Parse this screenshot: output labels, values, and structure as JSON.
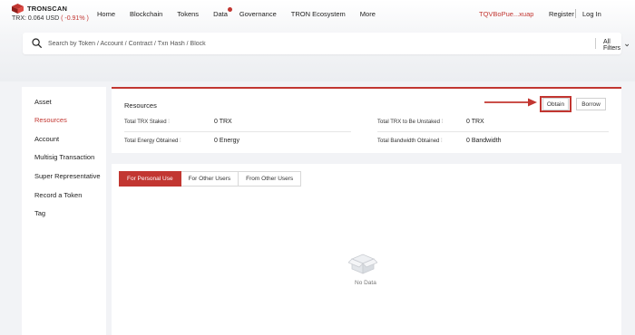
{
  "header": {
    "brand": "TRONSCAN",
    "price_label": "TRX: 0.064 USD",
    "price_change": "( -0.91% )",
    "nav": [
      "Home",
      "Blockchain",
      "Tokens",
      "Data",
      "Governance",
      "TRON Ecosystem",
      "More"
    ],
    "account": "TQVBoPue...xuap",
    "register": "Register",
    "login": "Log In"
  },
  "search": {
    "placeholder": "Search by Token / Account / Contract / Txn Hash / Block",
    "filter_label": "All Filters"
  },
  "sidebar": {
    "items": [
      {
        "label": "Asset"
      },
      {
        "label": "Resources"
      },
      {
        "label": "Account"
      },
      {
        "label": "Multisig Transaction"
      },
      {
        "label": "Super Representative"
      },
      {
        "label": "Record a Token"
      },
      {
        "label": "Tag"
      }
    ],
    "active_index": 1
  },
  "resources": {
    "title": "Resources",
    "obtain_label": "Obtain",
    "borrow_label": "Borrow",
    "stats": [
      {
        "label": "Total TRX Staked",
        "value": "0 TRX"
      },
      {
        "label": "Total TRX to Be Unstaked",
        "value": "0 TRX"
      },
      {
        "label": "Total Energy Obtained",
        "value": "0 Energy"
      },
      {
        "label": "Total Bandwidth Obtained",
        "value": "0 Bandwidth"
      }
    ]
  },
  "tabs": {
    "items": [
      "For Personal Use",
      "For Other Users",
      "From Other Users"
    ],
    "active_index": 0
  },
  "empty_state": {
    "text": "No Data"
  },
  "colors": {
    "accent": "#c23631",
    "page_bg": "#f2f3f6"
  }
}
